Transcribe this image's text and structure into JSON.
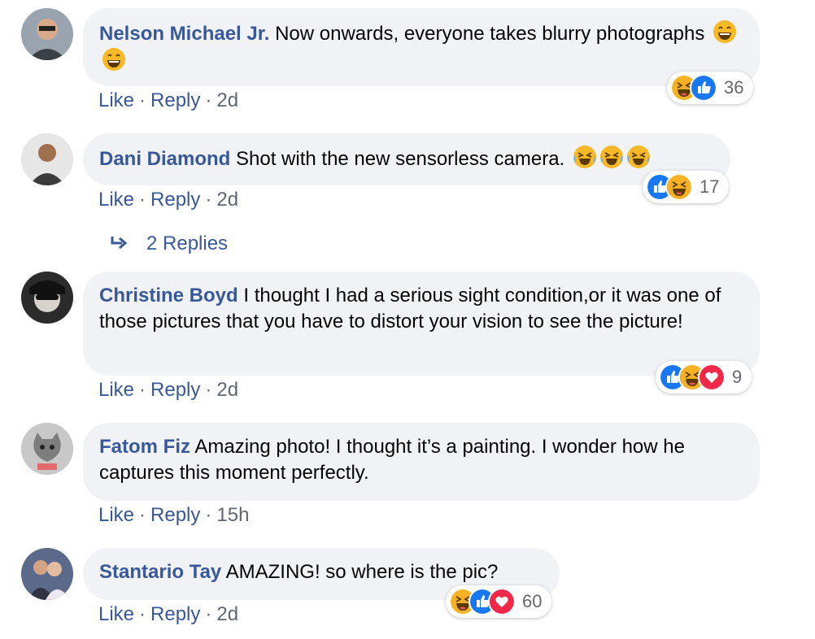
{
  "comments": [
    {
      "author": "Nelson Michael Jr.",
      "text": "Now onwards, everyone takes blurry photographs",
      "emoji_count": 2,
      "actions": {
        "like": "Like",
        "reply": "Reply",
        "time": "2d"
      },
      "reaction_count": "36",
      "reactions": [
        "haha",
        "like"
      ]
    },
    {
      "author": "Dani Diamond",
      "text": "Shot with the new sensorless camera.",
      "emoji_count": 3,
      "actions": {
        "like": "Like",
        "reply": "Reply",
        "time": "2d"
      },
      "reaction_count": "17",
      "reactions": [
        "like",
        "haha"
      ],
      "replies_label": "2 Replies"
    },
    {
      "author": "Christine Boyd",
      "text": "I thought I had a serious sight condition,or it was one of those pictures that you have to distort your vision to see the picture!",
      "actions": {
        "like": "Like",
        "reply": "Reply",
        "time": "2d"
      },
      "reaction_count": "9",
      "reactions": [
        "like",
        "haha",
        "love"
      ]
    },
    {
      "author": "Fatom Fiz",
      "text": "Amazing photo! I thought it’s a painting. I wonder how he captures this moment perfectly.",
      "actions": {
        "like": "Like",
        "reply": "Reply",
        "time": "15h"
      }
    },
    {
      "author": "Stantario Tay",
      "text": "AMAZING! so where is the pic?",
      "actions": {
        "like": "Like",
        "reply": "Reply",
        "time": "2d"
      },
      "reaction_count": "60",
      "reactions": [
        "haha",
        "like",
        "love"
      ]
    }
  ],
  "colors": {
    "link": "#385898",
    "bubble": "#f0f2f5",
    "like_blue": "#1877f2",
    "love_red": "#f02849",
    "haha_yellow": "#f7b125"
  }
}
